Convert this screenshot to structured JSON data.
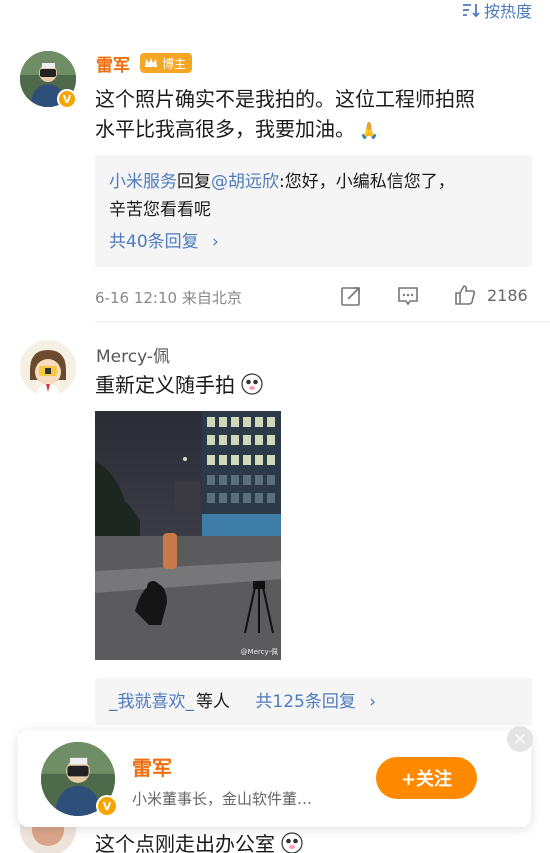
{
  "sort": {
    "label": "按热度"
  },
  "comments": [
    {
      "author": "雷军",
      "tag": "博主",
      "text_line1": "这个照片确实不是我拍的。这位工程师拍照",
      "text_line2": "水平比我高很多，我要加油。",
      "emoji": "🙏",
      "reply": {
        "author": "小米服务",
        "reply_word": "回复",
        "mention": "@胡远欣",
        "text_part1": ":您好，小编私信您了，",
        "text_line2": "辛苦您看看呢",
        "more": "共40条回复"
      },
      "date": "6-16",
      "time": "12:10",
      "location": "来自北京",
      "likes": "2186"
    },
    {
      "author": "Mercy-佩",
      "text": "重新定义随手拍",
      "photo_watermark": "@Mercy-佩",
      "reply": {
        "author": "_我就喜欢_",
        "suffix": "等人",
        "more": "共125条回复"
      }
    },
    {
      "text": "这个点刚走出办公室"
    }
  ],
  "popup": {
    "name": "雷军",
    "desc": "小米董事长，金山软件董…",
    "follow": "+关注",
    "close": "×"
  },
  "colors": {
    "accent": "#ff8a00",
    "link": "#4d7bbd",
    "name": "#f06f10"
  }
}
